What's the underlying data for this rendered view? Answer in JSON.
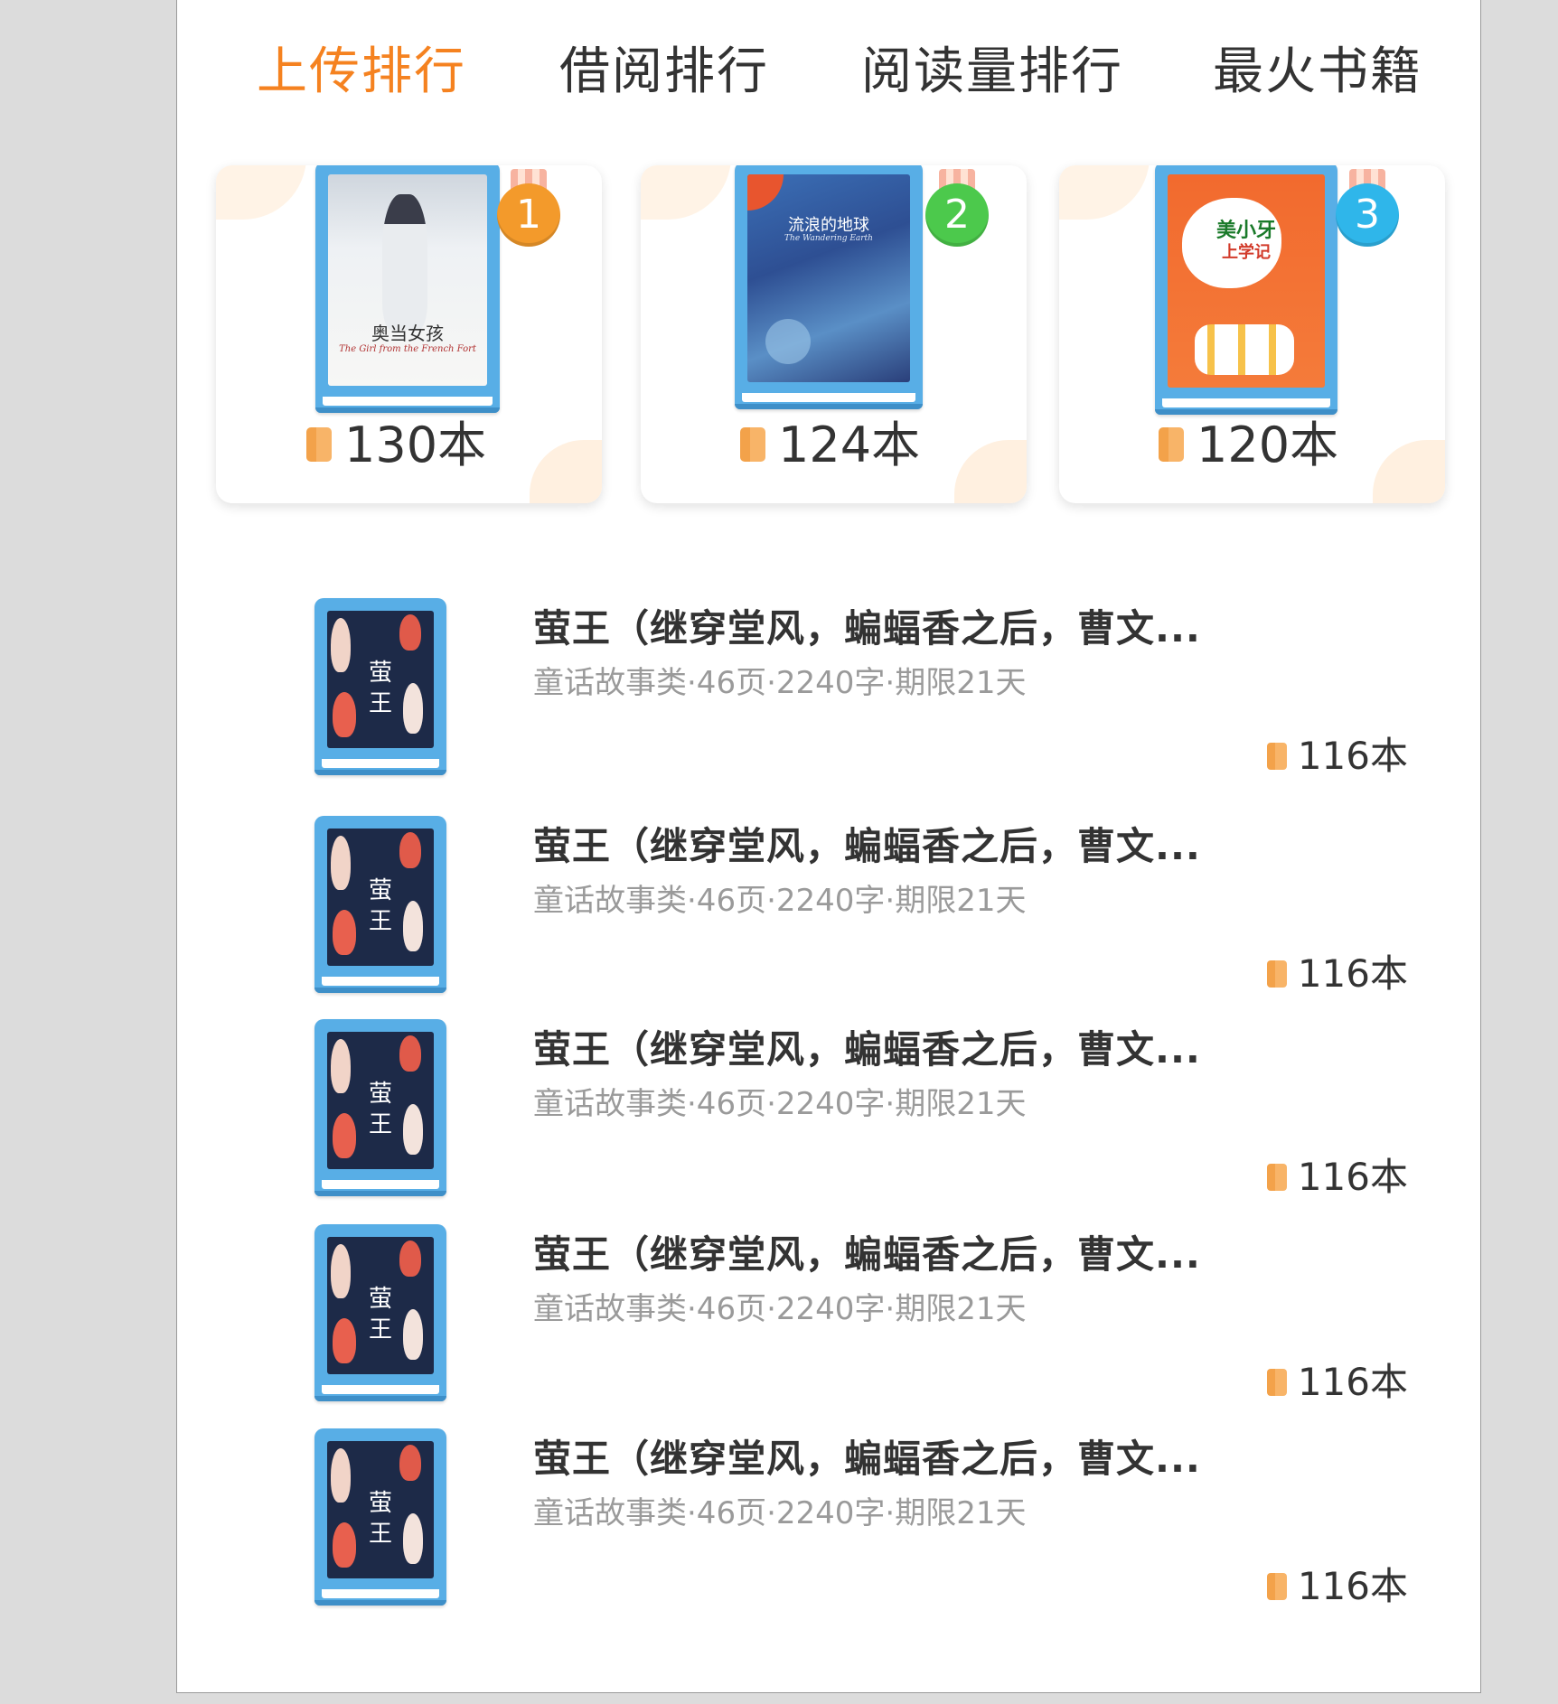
{
  "tabs": [
    {
      "label": "上传排行",
      "active": true
    },
    {
      "label": "借阅排行",
      "active": false
    },
    {
      "label": "阅读量排行",
      "active": false
    },
    {
      "label": "最火书籍",
      "active": false
    }
  ],
  "top3": [
    {
      "rank": "1",
      "count": "130本",
      "medal_color": "#f39a2b",
      "cover": {
        "title": "奥当女孩",
        "subtitle": "The Girl from the French Fort"
      }
    },
    {
      "rank": "2",
      "count": "124本",
      "medal_color": "#4cc94c",
      "cover": {
        "title": "流浪的地球",
        "subtitle": "The Wandering Earth"
      }
    },
    {
      "rank": "3",
      "count": "120本",
      "medal_color": "#2fb6ea",
      "cover": {
        "title": "美小牙",
        "subtitle": "上学记"
      }
    }
  ],
  "list": [
    {
      "title": "萤王（继穿堂风，蝙蝠香之后，曹文...",
      "meta": "童话故事类·46页·2240字·期限21天",
      "count": "116本",
      "cover_title": "萤王"
    },
    {
      "title": "萤王（继穿堂风，蝙蝠香之后，曹文...",
      "meta": "童话故事类·46页·2240字·期限21天",
      "count": "116本",
      "cover_title": "萤王"
    },
    {
      "title": "萤王（继穿堂风，蝙蝠香之后，曹文...",
      "meta": "童话故事类·46页·2240字·期限21天",
      "count": "116本",
      "cover_title": "萤王"
    },
    {
      "title": "萤王（继穿堂风，蝙蝠香之后，曹文...",
      "meta": "童话故事类·46页·2240字·期限21天",
      "count": "116本",
      "cover_title": "萤王"
    },
    {
      "title": "萤王（继穿堂风，蝙蝠香之后，曹文...",
      "meta": "童话故事类·46页·2240字·期限21天",
      "count": "116本",
      "cover_title": "萤王"
    }
  ],
  "colors": {
    "accent": "#f58220",
    "book_blue": "#58aee6",
    "text_primary": "#333333",
    "text_secondary": "#9a9a9a"
  },
  "icons": {
    "count": "book-icon",
    "rank": "medal-icon"
  }
}
